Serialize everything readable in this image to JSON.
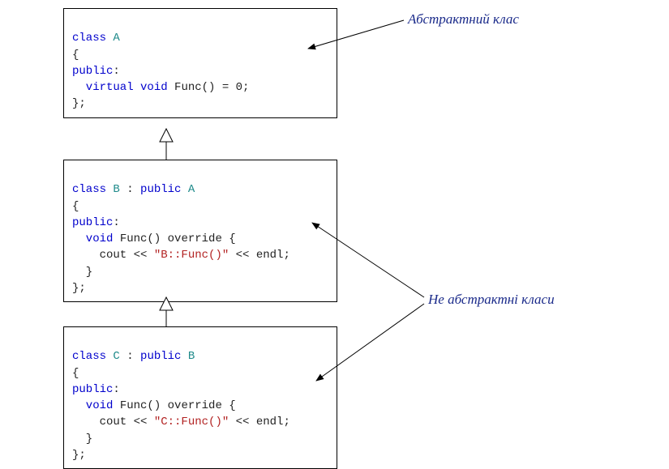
{
  "boxA": {
    "l1_kw_class": "class",
    "l1_typ": "A",
    "l2": "{",
    "l3_kw": "public",
    "l3_rest": ":",
    "l4_kw1": "  virtual",
    "l4_kw2": "void",
    "l4_rest": "Func() = 0;",
    "l5": "};"
  },
  "boxB": {
    "l1_kw_class": "class",
    "l1_typ1": "B",
    "l1_sep": " : ",
    "l1_kw_pub": "public",
    "l1_typ2": "A",
    "l2": "{",
    "l3_kw": "public",
    "l3_rest": ":",
    "l4_kw": "  void",
    "l4_rest": "Func() override {",
    "l5_pre": "    cout << ",
    "l5_str": "\"B::Func()\"",
    "l5_post": " << endl;",
    "l6": "  }",
    "l7": "};"
  },
  "boxC": {
    "l1_kw_class": "class",
    "l1_typ1": "C",
    "l1_sep": " : ",
    "l1_kw_pub": "public",
    "l1_typ2": "B",
    "l2": "{",
    "l3_kw": "public",
    "l3_rest": ":",
    "l4_kw": "  void",
    "l4_rest": "Func() override {",
    "l5_pre": "    cout << ",
    "l5_str": "\"C::Func()\"",
    "l5_post": " << endl;",
    "l6": "  }",
    "l7": "};"
  },
  "annotations": {
    "abstract": "Абстрактний клас",
    "non_abstract": "Не абстрактні класи"
  }
}
